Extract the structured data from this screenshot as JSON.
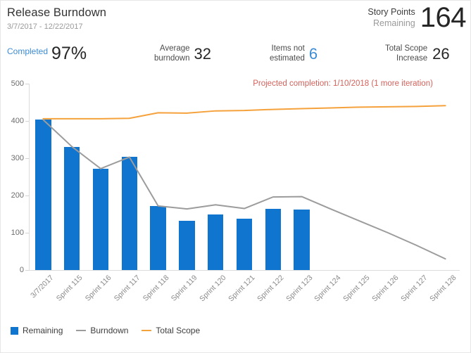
{
  "header": {
    "title": "Release Burndown",
    "date_range": "3/7/2017 - 12/22/2017",
    "kpis": {
      "story_points": {
        "label_line1": "Story Points",
        "label_line2": "Remaining",
        "value": "164"
      },
      "completed": {
        "label": "Completed",
        "value": "97%"
      },
      "average_burndown": {
        "label_line1": "Average",
        "label_line2": "burndown",
        "value": "32"
      },
      "items_not_estimated": {
        "label_line1": "Items not",
        "label_line2": "estimated",
        "value": "6"
      },
      "total_scope_increase": {
        "label_line1": "Total Scope",
        "label_line2": "Increase",
        "value": "26"
      }
    }
  },
  "chart_data": {
    "type": "bar",
    "title": "Release Burndown",
    "xlabel": "",
    "ylabel": "",
    "ylim": [
      0,
      500
    ],
    "yticks": [
      0,
      100,
      200,
      300,
      400,
      500
    ],
    "grid": false,
    "legend_position": "bottom-left",
    "categories": [
      "3/7/2017",
      "Sprint 115",
      "Sprint 116",
      "Sprint 117",
      "Sprint 118",
      "Sprint 119",
      "Sprint 120",
      "Sprint 121",
      "Sprint 122",
      "Sprint 123",
      "Sprint 124",
      "Sprint 125",
      "Sprint 126",
      "Sprint 127",
      "Sprint 128"
    ],
    "series": [
      {
        "name": "Remaining",
        "type": "bar",
        "color": "#0f75cf",
        "values": [
          403,
          331,
          272,
          303,
          172,
          132,
          150,
          138,
          164,
          162,
          null,
          null,
          null,
          null,
          null
        ]
      },
      {
        "name": "Burndown",
        "type": "line",
        "color": "#9c9c9c",
        "values": [
          403,
          331,
          272,
          303,
          172,
          164,
          175,
          165,
          196,
          197,
          164,
          132,
          100,
          66,
          30
        ]
      },
      {
        "name": "Total Scope",
        "type": "line",
        "color": "#f5a23c",
        "values": [
          406,
          406,
          406,
          407,
          422,
          421,
          427,
          428,
          431,
          433,
          435,
          437,
          438,
          439,
          441
        ]
      }
    ],
    "annotations": [
      {
        "text": "Projected completion: 1/10/2018 (1 more iteration)",
        "color": "#d4615b"
      }
    ]
  },
  "legend": {
    "items": [
      {
        "label": "Remaining",
        "marker": "square-swatch",
        "color": "#0f75cf"
      },
      {
        "label": "Burndown",
        "marker": "line-swatch",
        "color": "#9c9c9c"
      },
      {
        "label": "Total Scope",
        "marker": "line-swatch",
        "color": "#f5a23c"
      }
    ]
  }
}
